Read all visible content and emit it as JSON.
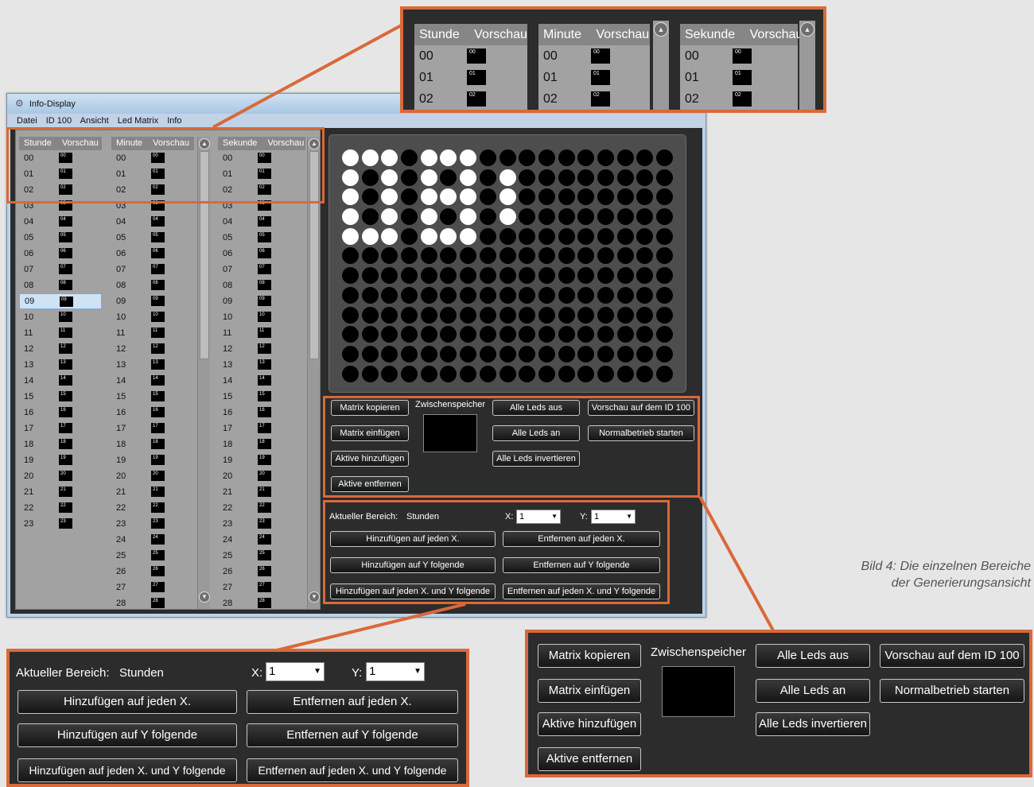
{
  "window": {
    "title": "Info-Display",
    "menu": [
      "Datei",
      "ID 100",
      "Ansicht",
      "Led Matrix",
      "Info"
    ]
  },
  "lists": {
    "stunde": {
      "header": [
        "Stunde",
        "Vorschau"
      ],
      "items": [
        "00",
        "01",
        "02",
        "03",
        "04",
        "05",
        "06",
        "07",
        "08",
        "09",
        "10",
        "11",
        "12",
        "13",
        "14",
        "15",
        "16",
        "17",
        "18",
        "19",
        "20",
        "21",
        "22",
        "23"
      ],
      "selected": "09"
    },
    "minute": {
      "header": [
        "Minute",
        "Vorschau"
      ],
      "items": [
        "00",
        "01",
        "02",
        "03",
        "04",
        "05",
        "06",
        "07",
        "08",
        "09",
        "10",
        "11",
        "12",
        "13",
        "14",
        "15",
        "16",
        "17",
        "18",
        "19",
        "20",
        "21",
        "22",
        "23",
        "24",
        "25",
        "26",
        "27",
        "28"
      ]
    },
    "sekunde": {
      "header": [
        "Sekunde",
        "Vorschau"
      ],
      "items": [
        "00",
        "01",
        "02",
        "03",
        "04",
        "05",
        "06",
        "07",
        "08",
        "09",
        "10",
        "11",
        "12",
        "13",
        "14",
        "15",
        "16",
        "17",
        "18",
        "19",
        "20",
        "21",
        "22",
        "23",
        "24",
        "25",
        "26",
        "27",
        "28"
      ]
    }
  },
  "matrix": {
    "cols": 17,
    "rows": 12,
    "on_rows": [
      "11101110000000000",
      "10101010100000000",
      "10101110100000000",
      "10101010100000000",
      "11101110000000000",
      "00000000000000000",
      "00000000000000000",
      "00000000000000000",
      "00000000000000000",
      "00000000000000000",
      "00000000000000000",
      "00000000000000000"
    ]
  },
  "actions": {
    "matrix_copy": "Matrix kopieren",
    "matrix_paste": "Matrix einfügen",
    "active_add": "Aktive hinzufügen",
    "active_remove": "Aktive entfernen",
    "clipboard": "Zwischenspeicher",
    "all_off": "Alle Leds aus",
    "all_on": "Alle Leds an",
    "all_invert": "Alle Leds invertieren",
    "preview_id100": "Vorschau auf dem ID 100",
    "normal_start": "Normalbetrieb starten"
  },
  "range": {
    "current_label": "Aktueller Bereich:",
    "current_value": "Stunden",
    "x_label": "X:",
    "x_value": "1",
    "y_label": "Y:",
    "y_value": "1",
    "add_each_x": "Hinzufügen auf jeden X.",
    "remove_each_x": "Entfernen auf jeden X.",
    "add_y_following": "Hinzufügen auf Y folgende",
    "remove_y_following": "Entfernen auf Y folgende",
    "add_each_x_y_following": "Hinzufügen auf jeden X. und Y folgende",
    "remove_each_x_y_following": "Entfernen auf jeden X. und Y folgende"
  },
  "zoom_top_rows": [
    "00",
    "01",
    "02"
  ],
  "caption": {
    "line1": "Bild 4: Die einzelnen Bereiche",
    "line2": "der Generierungsansicht"
  },
  "colors": {
    "highlight": "#d9693a",
    "led_on": "#ffffff",
    "led_off": "#000000",
    "panel_dark": "#2c2c2c"
  }
}
